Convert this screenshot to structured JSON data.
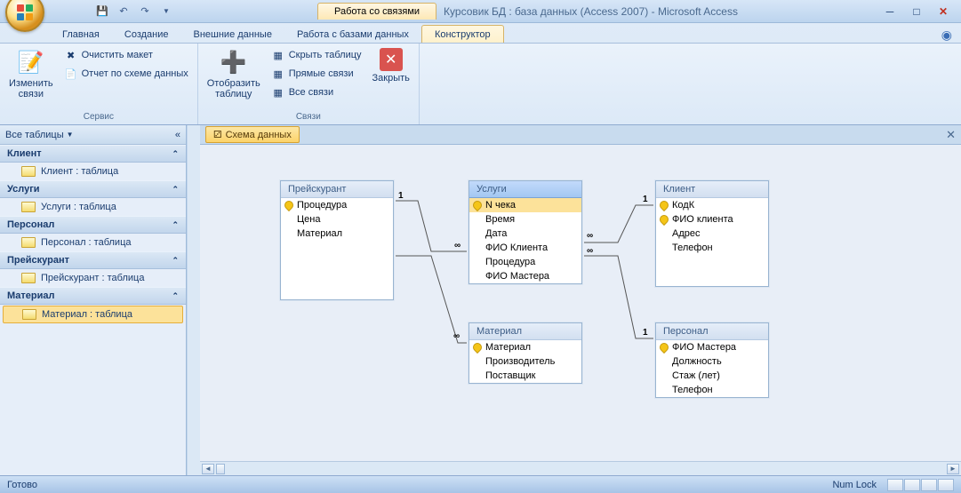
{
  "titlebar": {
    "context_label": "Работа со связями",
    "title": "Курсовик БД : база данных (Access 2007) - Microsoft Access"
  },
  "tabs": {
    "home": "Главная",
    "create": "Создание",
    "external": "Внешние данные",
    "dbtools": "Работа с базами данных",
    "constructor": "Конструктор"
  },
  "ribbon": {
    "edit_rel": "Изменить\nсвязи",
    "clear_layout": "Очистить макет",
    "schema_report": "Отчет по схеме данных",
    "grp_service": "Сервис",
    "show_table": "Отобразить\nтаблицу",
    "hide_table": "Скрыть таблицу",
    "direct_rel": "Прямые связи",
    "all_rel": "Все связи",
    "grp_rel": "Связи",
    "close": "Закрыть"
  },
  "nav": {
    "header": "Все таблицы",
    "groups": [
      {
        "title": "Клиент",
        "items": [
          "Клиент : таблица"
        ]
      },
      {
        "title": "Услуги",
        "items": [
          "Услуги : таблица"
        ]
      },
      {
        "title": "Персонал",
        "items": [
          "Персонал : таблица"
        ]
      },
      {
        "title": "Прейскурант",
        "items": [
          "Прейскурант : таблица"
        ]
      },
      {
        "title": "Материал",
        "items": [
          "Материал : таблица"
        ]
      }
    ]
  },
  "doc": {
    "tab": "Схема данных"
  },
  "tables": {
    "preis": {
      "title": "Прейскурант",
      "f0": "Процедура",
      "f1": "Цена",
      "f2": "Материал"
    },
    "uslugi": {
      "title": "Услуги",
      "f0": "N чека",
      "f1": "Время",
      "f2": "Дата",
      "f3": "ФИО Клиента",
      "f4": "Процедура",
      "f5": "ФИО Мастера"
    },
    "klient": {
      "title": "Клиент",
      "f0": "КодК",
      "f1": "ФИО клиента",
      "f2": "Адрес",
      "f3": "Телефон"
    },
    "material": {
      "title": "Материал",
      "f0": "Материал",
      "f1": "Производитель",
      "f2": "Поставщик"
    },
    "personal": {
      "title": "Персонал",
      "f0": "ФИО Мастера",
      "f1": "Должность",
      "f2": "Стаж (лет)",
      "f3": "Телефон"
    }
  },
  "status": {
    "ready": "Готово",
    "numlock": "Num Lock"
  }
}
